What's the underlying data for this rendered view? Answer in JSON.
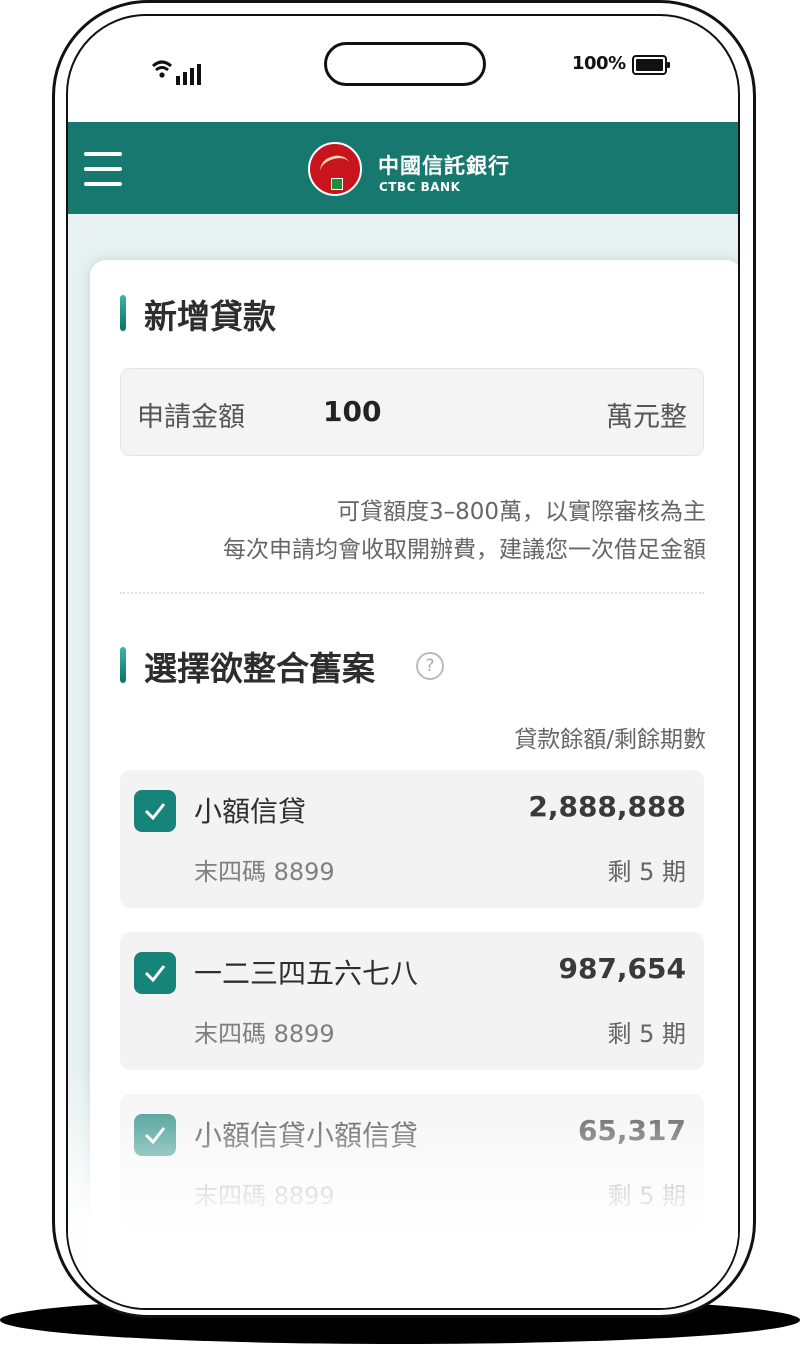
{
  "status_bar": {
    "battery_percent": "100%",
    "icons": [
      "wifi-icon",
      "signal-icon",
      "battery-icon"
    ]
  },
  "header": {
    "brand_name": "中國信託銀行",
    "brand_english": "CTBC BANK",
    "menu_icon": "hamburger-menu-icon",
    "logo_icon": "ctbc-logo-icon"
  },
  "new_loan": {
    "title": "新增貸款",
    "amount_label": "申請金額",
    "amount_value": "100",
    "amount_unit": "萬元整",
    "note_line1": "可貸額度3–800萬，以實際審核為主",
    "note_line2": "每次申請均會收取開辦費，建議您一次借足金額"
  },
  "consolidation": {
    "title": "選擇欲整合舊案",
    "help_icon": "question-circle-icon",
    "column_header": "貸款餘額/剩餘期數",
    "loans": [
      {
        "checked": true,
        "name": "小額信貸",
        "amount": "2,888,888",
        "last_four": "末四碼 8899",
        "remaining": "剩 5 期"
      },
      {
        "checked": true,
        "name": "一二三四五六七八",
        "amount": "987,654",
        "last_four": "末四碼 8899",
        "remaining": "剩 5 期"
      },
      {
        "checked": true,
        "name": "小額信貸小額信貸",
        "amount": "65,317",
        "last_four": "末四碼 8899",
        "remaining": "剩 5 期"
      }
    ]
  },
  "colors": {
    "primary": "#17786f",
    "checkbox": "#17847a",
    "logo_red": "#c8141d",
    "screen_background": "#e8f1f2"
  }
}
